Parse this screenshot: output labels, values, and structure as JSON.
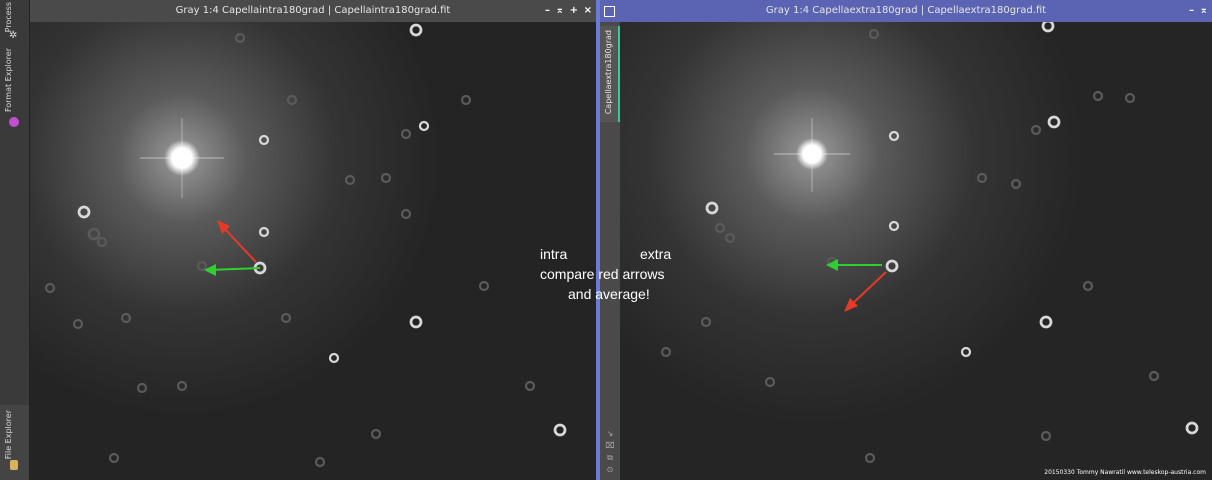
{
  "sidebar": {
    "tabs": [
      {
        "label": "Process",
        "icon": "gear-icon"
      },
      {
        "label": "Format Explorer",
        "icon": "format-icon"
      },
      {
        "label": "File Explorer",
        "icon": "cylinder-icon"
      }
    ]
  },
  "left_window": {
    "title": "Gray 1:4 Capellaintra180grad | Capellaintra180grad.fit",
    "controls": [
      "–",
      "⌅",
      "+",
      "×"
    ],
    "colors": {
      "titlebar": "#4a4a4a",
      "arrow_red": "#e63a26",
      "arrow_green": "#2fcf2f"
    }
  },
  "right_window": {
    "title": "Gray 1:4 Capellaextra180grad | Capellaextra180grad.fit",
    "controls": [
      "–",
      "⌅",
      "+"
    ],
    "side_tab": "Capellaextra180grad",
    "colors": {
      "titlebar": "#5b63b3",
      "border": "#6a7bd8"
    }
  },
  "overlay": {
    "intra": "intra",
    "extra": "extra",
    "line2": "compare red arrows",
    "line3": "and average!"
  },
  "credit": "20150330  Tommy Nawratil   www.teleskop-austria.com"
}
